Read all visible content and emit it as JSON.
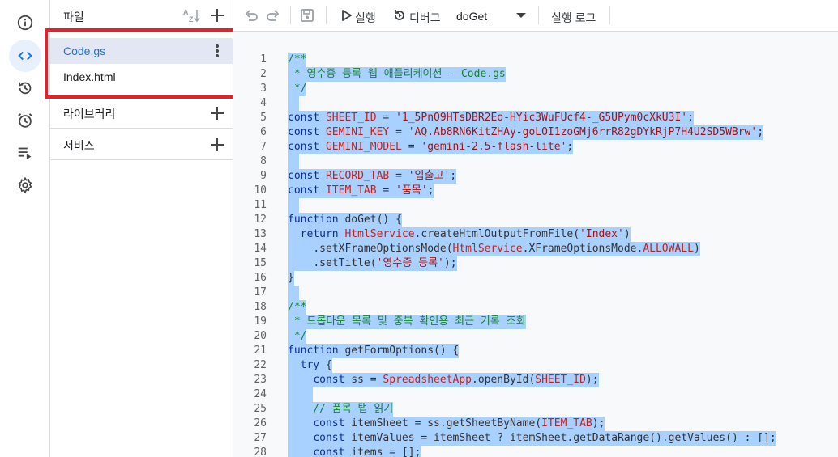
{
  "rail": {
    "items": [
      {
        "icon": "info-icon",
        "name": "rail-overview"
      },
      {
        "icon": "code-icon",
        "name": "rail-editor",
        "active": true
      },
      {
        "icon": "history-icon",
        "name": "rail-history"
      },
      {
        "icon": "alarm-icon",
        "name": "rail-triggers"
      },
      {
        "icon": "executions-icon",
        "name": "rail-executions"
      },
      {
        "icon": "gear-icon",
        "name": "rail-settings"
      }
    ]
  },
  "files": {
    "title": "파일",
    "sort_icon": "sort-az-icon",
    "items": [
      {
        "label": "Code.gs",
        "selected": true
      },
      {
        "label": "Index.html",
        "selected": false
      }
    ]
  },
  "libraries": {
    "label": "라이브러리"
  },
  "services": {
    "label": "서비스"
  },
  "toolbar": {
    "run_label": "실행",
    "debug_label": "디버그",
    "function_value": "doGet",
    "log_label": "실행 로그"
  },
  "editor": {
    "selection_color": "#a8d1ff",
    "lines": [
      {
        "n": "1",
        "text": "/**"
      },
      {
        "n": "2",
        "text": " * 영수증 등록 웹 애플리케이션 - Code.gs"
      },
      {
        "n": "3",
        "text": " */"
      },
      {
        "n": "4",
        "text": ""
      },
      {
        "n": "5",
        "text": "const SHEET_ID = '1_5PnQ9HTsDBR2Eo-HYic3WuFUcf4-_G5UPym0cXkU3I';"
      },
      {
        "n": "6",
        "text": "const GEMINI_KEY = 'AQ.Ab8RN6KitZHAy-goLOI1zoGMj6rrR82gDYkRjP7H4U2SD5WBrw';"
      },
      {
        "n": "7",
        "text": "const GEMINI_MODEL = 'gemini-2.5-flash-lite';"
      },
      {
        "n": "8",
        "text": ""
      },
      {
        "n": "9",
        "text": "const RECORD_TAB = '입출고';"
      },
      {
        "n": "10",
        "text": "const ITEM_TAB = '품목';"
      },
      {
        "n": "11",
        "text": ""
      },
      {
        "n": "12",
        "text": "function doGet() {"
      },
      {
        "n": "13",
        "text": "  return HtmlService.createHtmlOutputFromFile('Index')"
      },
      {
        "n": "14",
        "text": "    .setXFrameOptionsMode(HtmlService.XFrameOptionsMode.ALLOWALL)"
      },
      {
        "n": "15",
        "text": "    .setTitle('영수증 등록');"
      },
      {
        "n": "16",
        "text": "}"
      },
      {
        "n": "17",
        "text": ""
      },
      {
        "n": "18",
        "text": "/**"
      },
      {
        "n": "19",
        "text": " * 드롭다운 목록 및 중복 확인용 최근 기록 조회"
      },
      {
        "n": "20",
        "text": " */"
      },
      {
        "n": "21",
        "text": "function getFormOptions() {"
      },
      {
        "n": "22",
        "text": "  try {"
      },
      {
        "n": "23",
        "text": "    const ss = SpreadsheetApp.openById(SHEET_ID);"
      },
      {
        "n": "24",
        "text": "    "
      },
      {
        "n": "25",
        "text": "    // 품목 탭 읽기"
      },
      {
        "n": "26",
        "text": "    const itemSheet = ss.getSheetByName(ITEM_TAB);"
      },
      {
        "n": "27",
        "text": "    const itemValues = itemSheet ? itemSheet.getDataRange().getValues() : [];"
      },
      {
        "n": "28",
        "text": "    const items = [];"
      }
    ]
  }
}
